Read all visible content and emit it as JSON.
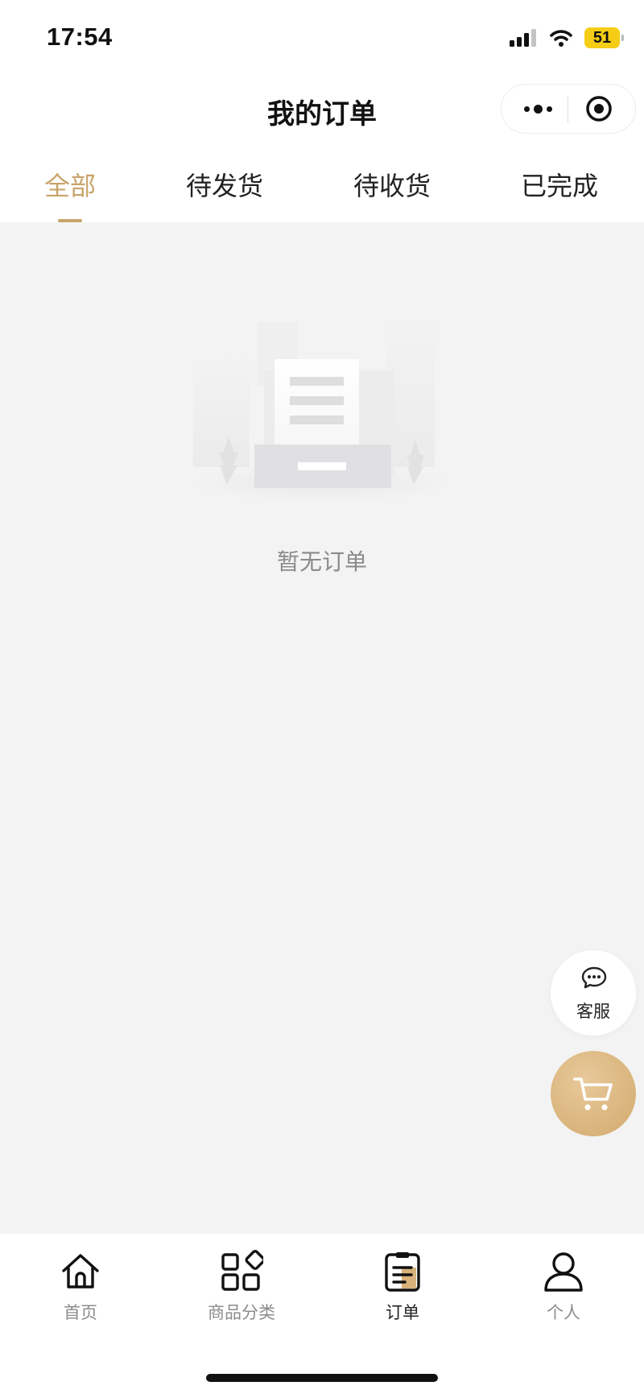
{
  "status_bar": {
    "time": "17:54",
    "battery": "51"
  },
  "nav": {
    "title": "我的订单"
  },
  "tabs": [
    {
      "label": "全部",
      "active": true
    },
    {
      "label": "待发货",
      "active": false
    },
    {
      "label": "待收货",
      "active": false
    },
    {
      "label": "已完成",
      "active": false
    }
  ],
  "empty_state": {
    "text": "暂无订单"
  },
  "floating": {
    "service_label": "客服"
  },
  "tab_bar": [
    {
      "label": "首页",
      "icon": "home-icon",
      "active": false
    },
    {
      "label": "商品分类",
      "icon": "category-icon",
      "active": false
    },
    {
      "label": "订单",
      "icon": "order-icon",
      "active": true
    },
    {
      "label": "个人",
      "icon": "person-icon",
      "active": false
    }
  ],
  "colors": {
    "accent": "#c8a46a",
    "background": "#f3f3f3",
    "cart_button": "#d8b27a"
  }
}
